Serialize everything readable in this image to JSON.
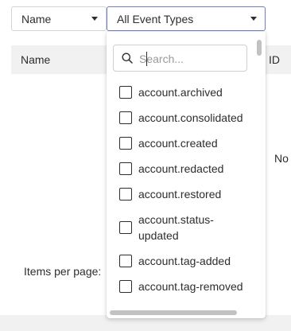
{
  "filters": {
    "field_select": {
      "value": "Name"
    },
    "event_type_select": {
      "value": "All Event Types"
    }
  },
  "table": {
    "columns": [
      "Name",
      "ID"
    ],
    "empty_message_fragment": "No"
  },
  "pagination": {
    "items_per_page_label": "Items per page:"
  },
  "dropdown": {
    "search": {
      "value": "",
      "placeholder": "Search..."
    },
    "options": [
      {
        "label": "account.archived",
        "checked": false
      },
      {
        "label": "account.consolidated",
        "checked": false
      },
      {
        "label": "account.created",
        "checked": false
      },
      {
        "label": "account.redacted",
        "checked": false
      },
      {
        "label": "account.restored",
        "checked": false
      },
      {
        "label": "account.status-updated",
        "checked": false
      },
      {
        "label": "account.tag-added",
        "checked": false
      },
      {
        "label": "account.tag-removed",
        "checked": false
      }
    ]
  },
  "icons": {
    "search": "search-icon",
    "caret": "caret-down-icon"
  },
  "colors": {
    "focus_border": "#6b7fc4",
    "header_bg": "#f1f1f1"
  }
}
